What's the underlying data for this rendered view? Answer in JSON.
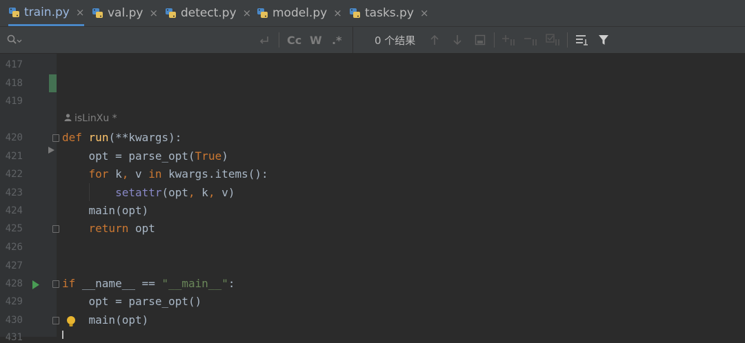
{
  "tabs": [
    {
      "label": "train.py",
      "active": true
    },
    {
      "label": "val.py",
      "active": false
    },
    {
      "label": "detect.py",
      "active": false
    },
    {
      "label": "model.py",
      "active": false
    },
    {
      "label": "tasks.py",
      "active": false
    }
  ],
  "tab_close_glyph": "×",
  "find": {
    "search_icon": "search-icon",
    "option_match_case": "Cc",
    "option_words": "W",
    "option_regex": ".*",
    "results_text": "0 个结果"
  },
  "line_numbers": [
    "417",
    "418",
    "419",
    "420",
    "421",
    "422",
    "423",
    "424",
    "425",
    "426",
    "427",
    "428",
    "429",
    "430",
    "431"
  ],
  "author_annotation": "isLinXu *",
  "code": {
    "l420": {
      "kw": "def",
      "name": "run",
      "rest": "(**kwargs):"
    },
    "l421": {
      "var": "opt",
      "rest": " = parse_opt(",
      "val": "True",
      "end": ")"
    },
    "l422": {
      "kw1": "for",
      "mid1": " k",
      "sep": ",",
      "mid2": " v ",
      "kw2": "in",
      "rest": " kwargs.items():"
    },
    "l423": {
      "builtin": "setattr",
      "a": "(opt",
      "c1": ",",
      "b": " k",
      "c2": ",",
      "d": " v)"
    },
    "l424": {
      "text": "main(opt)"
    },
    "l425": {
      "kw": "return",
      "rest": " opt"
    },
    "l428": {
      "kw": "if",
      "mid": " __name__ == ",
      "str": "\"__main__\"",
      "end": ":"
    },
    "l429": {
      "text": "opt = parse_opt()"
    },
    "l430": {
      "text": "main(opt)"
    }
  },
  "colors": {
    "keyword": "#cc7832",
    "function": "#ffc66d",
    "string": "#6a8759",
    "builtin": "#8888c6",
    "active_tab_underline": "#4a88c7",
    "run_arrow": "#499c54"
  }
}
